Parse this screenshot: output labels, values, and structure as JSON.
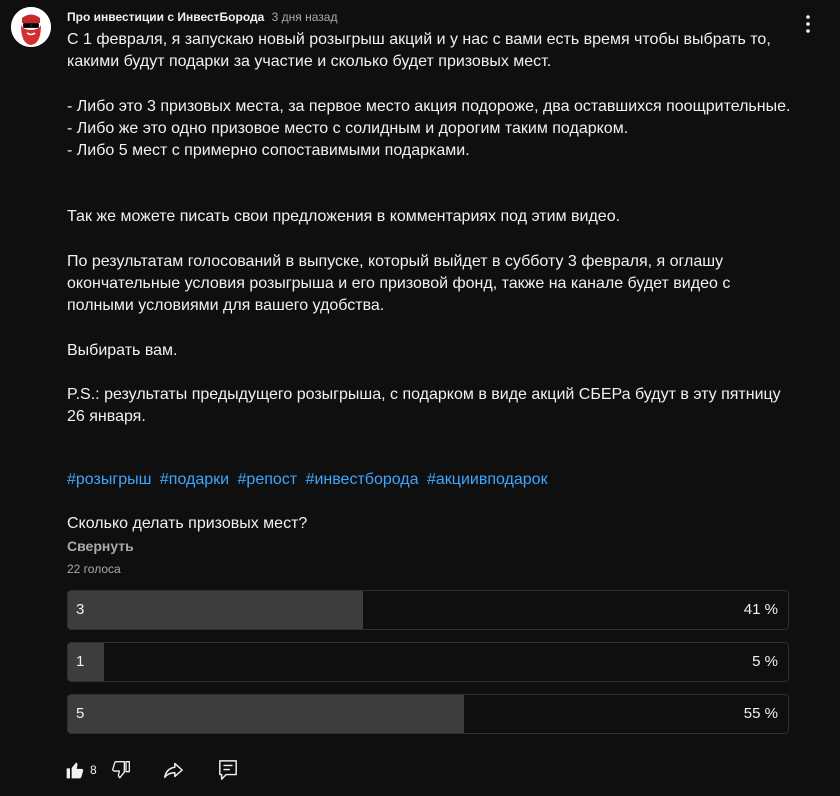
{
  "post": {
    "author": "Про инвестиции с ИнвестБорода",
    "time": "3 дня назад",
    "paragraphs": {
      "p1": "С 1 февраля, я запускаю новый розыгрыш акций и у нас с вами есть время чтобы выбрать то, какими будут подарки за участие и сколько будет призовых мест.",
      "p2a": "- Либо это 3 призовых места, за первое место акция подороже, два оставшихся поощрительные.",
      "p2b": "- Либо же это одно призовое место с солидным и дорогим таким подарком.",
      "p2c": "- Либо 5 мест с примерно сопоставимыми подарками.",
      "p3": "Так же можете писать свои предложения в комментариях под этим видео.",
      "p4": "По результатам голосований в выпуске, который выйдет в субботу 3 февраля, я оглашу окончательные условия розыгрыша и его призовой фонд, также на канале будет видео с полными условиями для вашего удобства.",
      "p5": "Выбирать вам.",
      "p6": "P.S.: результаты предыдущего розыгрыша, с подарком в виде акций СБЕРа будут в эту пятницу 26 января."
    },
    "hashtags": [
      "#розыгрыш",
      "#подарки",
      "#репост",
      "#инвестборода",
      "#акциивподарок"
    ]
  },
  "poll": {
    "question": "Сколько делать призовых мест?",
    "collapse_label": "Свернуть",
    "vote_count": "22 голоса",
    "options": [
      {
        "label": "3",
        "percent_text": "41 %",
        "fraction": 0.41
      },
      {
        "label": "1",
        "percent_text": "5 %",
        "fraction": 0.05
      },
      {
        "label": "5",
        "percent_text": "55 %",
        "fraction": 0.55
      }
    ]
  },
  "actions": {
    "like_count": "8"
  },
  "colors": {
    "background": "#0f0f0f",
    "text": "#f1f1f1",
    "secondary_text": "#aaaaaa",
    "link": "#3ea6ff",
    "poll_fill": "#3d3d3d",
    "poll_border": "#303030"
  },
  "icons": {
    "avatar": "bearded-man-avatar",
    "menu": "more-vert-icon",
    "like": "thumb-up-filled-icon",
    "dislike": "thumb-down-outline-icon",
    "share": "share-arrow-icon",
    "comment": "comment-icon"
  }
}
